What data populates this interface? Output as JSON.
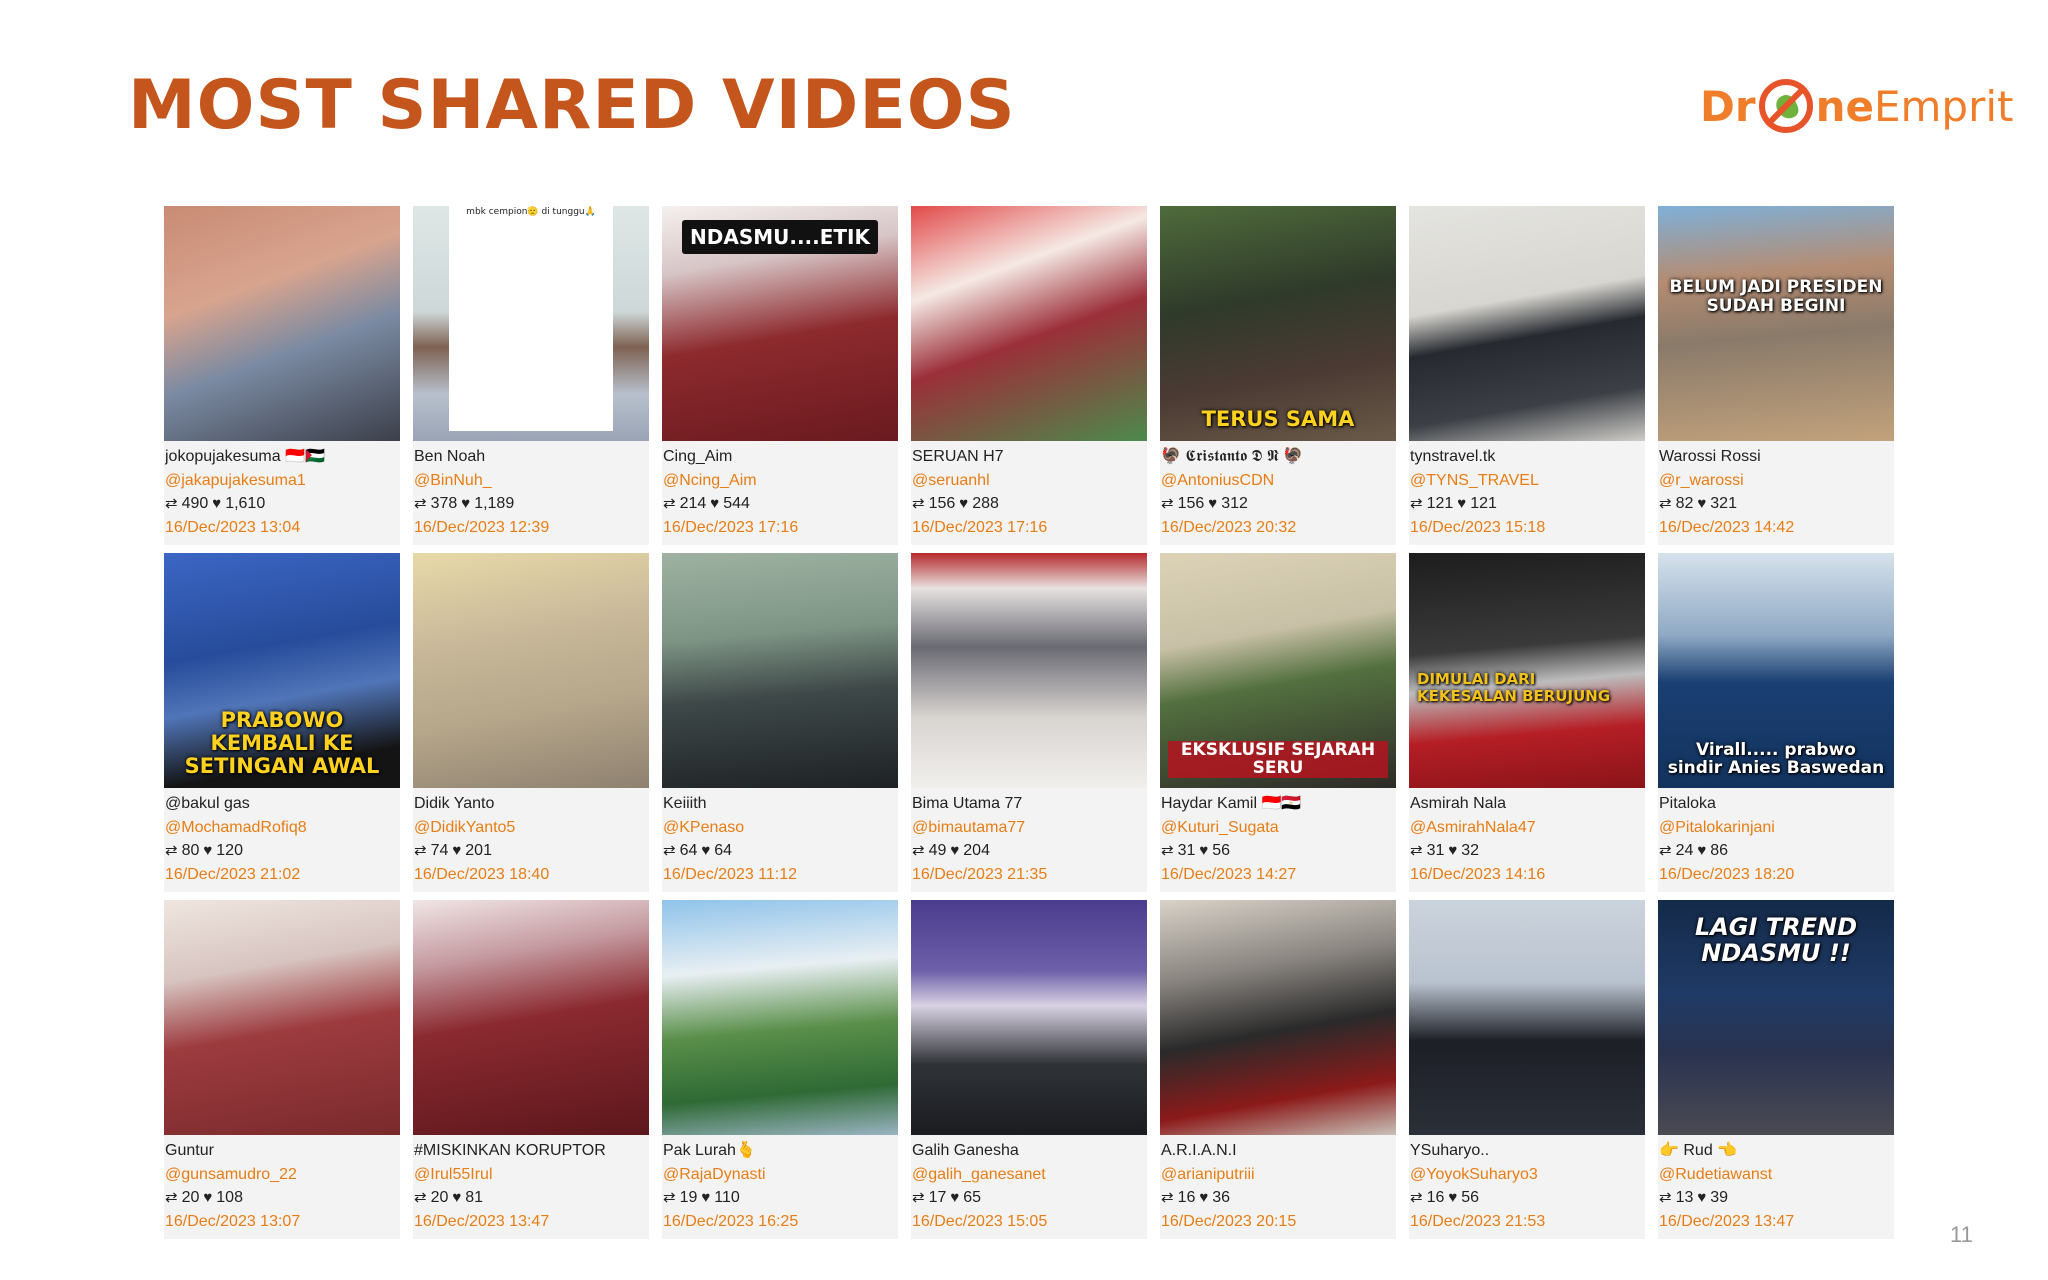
{
  "title": "MOST SHARED VIDEOS",
  "logo": {
    "part1": "Dr",
    "part2": "ne",
    "part3": "Emprit"
  },
  "page_number": "11",
  "icons": {
    "retweet": "retweet-icon",
    "heart": "heart-icon"
  },
  "videos": [
    {
      "name": "jokopujakesuma 🇮🇩🇵🇸",
      "handle": "@jakapujakesuma1",
      "shares": "490",
      "likes": "1,610",
      "date": "16/Dec/2023 13:04",
      "caption": "",
      "bg": "linear-gradient(160deg,#c98b74 0%,#d8a48e 35%,#7a8aa2 60%,#3c3f4a 100%)"
    },
    {
      "name": "Ben Noah",
      "handle": "@BinNuh_",
      "shares": "378",
      "likes": "1,189",
      "date": "16/Dec/2023 12:39",
      "caption": "mbk cempion🫡 di tunggu🙏",
      "bg": "linear-gradient(180deg,#dfe7e6 0%,#cdd7d8 45%,#7e6252 60%,#b7c0cc 80%,#9aa4b6 100%)"
    },
    {
      "name": "Cing_Aim",
      "handle": "@Ncing_Aim",
      "shares": "214",
      "likes": "544",
      "date": "16/Dec/2023 17:16",
      "caption": "NDASMU....ETIK",
      "bg": "linear-gradient(170deg,#f5f0ef 0%,#d7c5c6 25%,#8d2a2e 55%,#6a1a1f 100%)"
    },
    {
      "name": "SERUAN H7",
      "handle": "@seruanhl",
      "shares": "156",
      "likes": "288",
      "date": "16/Dec/2023 17:16",
      "caption": "",
      "bg": "linear-gradient(160deg,#e24a4a 0%,#f5e9e4 30%,#9b2f39 55%,#4c8a4c 100%)"
    },
    {
      "name": "🦃 𝕮𝖗𝖎𝖘𝖙𝖆𝖓𝖙𝖔 𝕯 𝕹 🦃",
      "handle": "@AntoniusCDN",
      "shares": "156",
      "likes": "312",
      "date": "16/Dec/2023 20:32",
      "caption": "TERUS SAMA",
      "bg": "linear-gradient(170deg,#4f6b3b 0%,#2f3a2a 40%,#4b3a33 70%,#6a5a48 100%)"
    },
    {
      "name": "tynstravel.tk",
      "handle": "@TYNS_TRAVEL",
      "shares": "121",
      "likes": "121",
      "date": "16/Dec/2023 15:18",
      "caption": "",
      "bg": "linear-gradient(170deg,#e4e4e0 0%,#d8d6d0 40%,#262a30 55%,#3c4046 80%,#cfcdc8 100%)"
    },
    {
      "name": "Warossi Rossi",
      "handle": "@r_warossi",
      "shares": "82",
      "likes": "321",
      "date": "16/Dec/2023 14:42",
      "caption": "BELUM JADI PRESIDEN SUDAH BEGINI",
      "bg": "linear-gradient(175deg,#7fb0d8 0%,#b48c72 30%,#8a7a6a 55%,#c2a27c 100%)"
    },
    {
      "name": "@bakul gas",
      "handle": "@MochamadRofiq8",
      "shares": "80",
      "likes": "120",
      "date": "16/Dec/2023 21:02",
      "caption": "PRABOWO KEMBALI KE SETINGAN AWAL",
      "bg": "linear-gradient(170deg,#3b66c4 0%,#274c9b 40%,#5075b8 60%,#141414 85%)"
    },
    {
      "name": "Didik Yanto",
      "handle": "@DidikYanto5",
      "shares": "74",
      "likes": "201",
      "date": "16/Dec/2023 18:40",
      "caption": "",
      "bg": "linear-gradient(170deg,#e8d9a8 0%,#c9b99a 35%,#b6a68a 65%,#8e8170 100%)"
    },
    {
      "name": "Keiiith",
      "handle": "@KPenaso",
      "shares": "64",
      "likes": "64",
      "date": "16/Dec/2023 11:12",
      "caption": "",
      "bg": "linear-gradient(175deg,#9fb2a2 0%,#7d9484 35%,#3e4848 60%,#1e2224 100%)"
    },
    {
      "name": "Bima Utama 77",
      "handle": "@bimautama77",
      "shares": "49",
      "likes": "204",
      "date": "16/Dec/2023 21:35",
      "caption": "",
      "bg": "linear-gradient(180deg,#b6282c 0%,#e7e2e0 15%,#6a6a74 40%,#d8d4d0 70%,#f1efed 100%)"
    },
    {
      "name": "Haydar Kamil 🇮🇩🇪🇬",
      "handle": "@Kuturi_Sugata",
      "shares": "31",
      "likes": "56",
      "date": "16/Dec/2023 14:27",
      "caption": "EKSKLUSIF SEJARAH SERU",
      "bg": "linear-gradient(170deg,#dcd3b7 0%,#c8c0a6 35%,#53703f 55%,#2d2b27 100%)"
    },
    {
      "name": "Asmirah Nala",
      "handle": "@AsmirahNala47",
      "shares": "31",
      "likes": "32",
      "date": "16/Dec/2023 14:16",
      "caption": "DIMULAI DARI KEKESALAN BERUJUNG",
      "bg": "linear-gradient(175deg,#1d1d1d 0%,#3a3a3a 40%,#bdbdbd 55%,#b51e25 75%,#8a1419 100%)"
    },
    {
      "name": "Pitaloka",
      "handle": "@Pitalokarinjani",
      "shares": "24",
      "likes": "86",
      "date": "16/Dec/2023 18:20",
      "caption": "Virall..... prabwo sindir Anies Baswedan",
      "bg": "linear-gradient(180deg,#d6e2ec 0%,#8fa9c4 35%,#1a3f73 55%,#13335e 100%)"
    },
    {
      "name": "Guntur",
      "handle": "@gunsamudro_22",
      "shares": "20",
      "likes": "108",
      "date": "16/Dec/2023 13:07",
      "caption": "",
      "bg": "linear-gradient(170deg,#efe6e0 0%,#d7c4c0 30%,#9d3b3f 55%,#7a2a2c 100%)"
    },
    {
      "name": "#MISKINKAN KORUPTOR",
      "handle": "@Irul55Irul",
      "shares": "20",
      "likes": "81",
      "date": "16/Dec/2023 13:47",
      "caption": "",
      "bg": "linear-gradient(170deg,#f1e6e6 0%,#c49aa0 25%,#8b2a30 50%,#5c171c 100%)"
    },
    {
      "name": "Pak Lurah🫰",
      "handle": "@RajaDynasti",
      "shares": "19",
      "likes": "110",
      "date": "16/Dec/2023 16:25",
      "caption": "",
      "bg": "linear-gradient(175deg,#8fc3ea 0%,#e8eff3 30%,#5a8f4a 55%,#2f6a35 80%,#9ab3c2 100%)"
    },
    {
      "name": "Galih Ganesha",
      "handle": "@galih_ganesanet",
      "shares": "17",
      "likes": "65",
      "date": "16/Dec/2023 15:05",
      "caption": "",
      "bg": "linear-gradient(180deg,#4b3c8e 0%,#6d5fa8 30%,#d8d2e2 45%,#2f3237 70%,#1a1c20 100%)"
    },
    {
      "name": "A.R.I.A.N.I",
      "handle": "@arianiputriii",
      "shares": "16",
      "likes": "36",
      "date": "16/Dec/2023 20:15",
      "caption": "",
      "bg": "linear-gradient(170deg,#d8d2c8 0%,#8a8580 30%,#2a2a2a 55%,#8b1a1a 80%,#c8c2b8 100%)"
    },
    {
      "name": "YSuharyo..",
      "handle": "@YoyokSuharyo3",
      "shares": "16",
      "likes": "56",
      "date": "16/Dec/2023 21:53",
      "caption": "",
      "bg": "linear-gradient(180deg,#cbd3dc 0%,#b9c3cf 35%,#1c1f26 60%,#2b2f38 100%)"
    },
    {
      "name": "👉 Rud 👈",
      "handle": "@Rudetiawanst",
      "shares": "13",
      "likes": "39",
      "date": "16/Dec/2023 13:47",
      "caption": "LAGI TREND NDASMU !!",
      "bg": "linear-gradient(180deg,#142a4a 0%,#1f3a66 40%,#2a3350 65%,#4a4a52 100%)"
    }
  ]
}
